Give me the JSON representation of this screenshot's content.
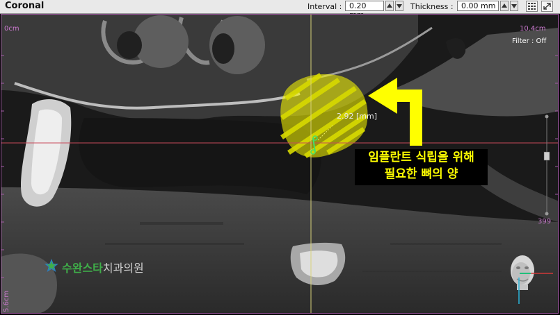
{
  "header": {
    "title": "Coronal",
    "interval_label": "Interval :",
    "interval_value": "0.20 mm",
    "thickness_label": "Thickness :",
    "thickness_value": "0.00 mm"
  },
  "viewport": {
    "scale_top_left": "0cm",
    "scale_top_right": "10.4cm",
    "scale_bottom_left": "5.6cm",
    "filter_text": "Filter :  Off",
    "slider_value": "399",
    "measurement": "2.92 [mm]"
  },
  "annotation": {
    "line1": "임플란트 식립을 위해",
    "line2": "필요한 뼈의 양"
  },
  "watermark": {
    "name_green": "수완스타",
    "name_rest": "치과의원"
  },
  "colors": {
    "overlay_text": "#cc7ad0",
    "highlight": "#ffff00",
    "crosshair_h": "#c84a5a",
    "crosshair_v": "#d8d27a"
  }
}
